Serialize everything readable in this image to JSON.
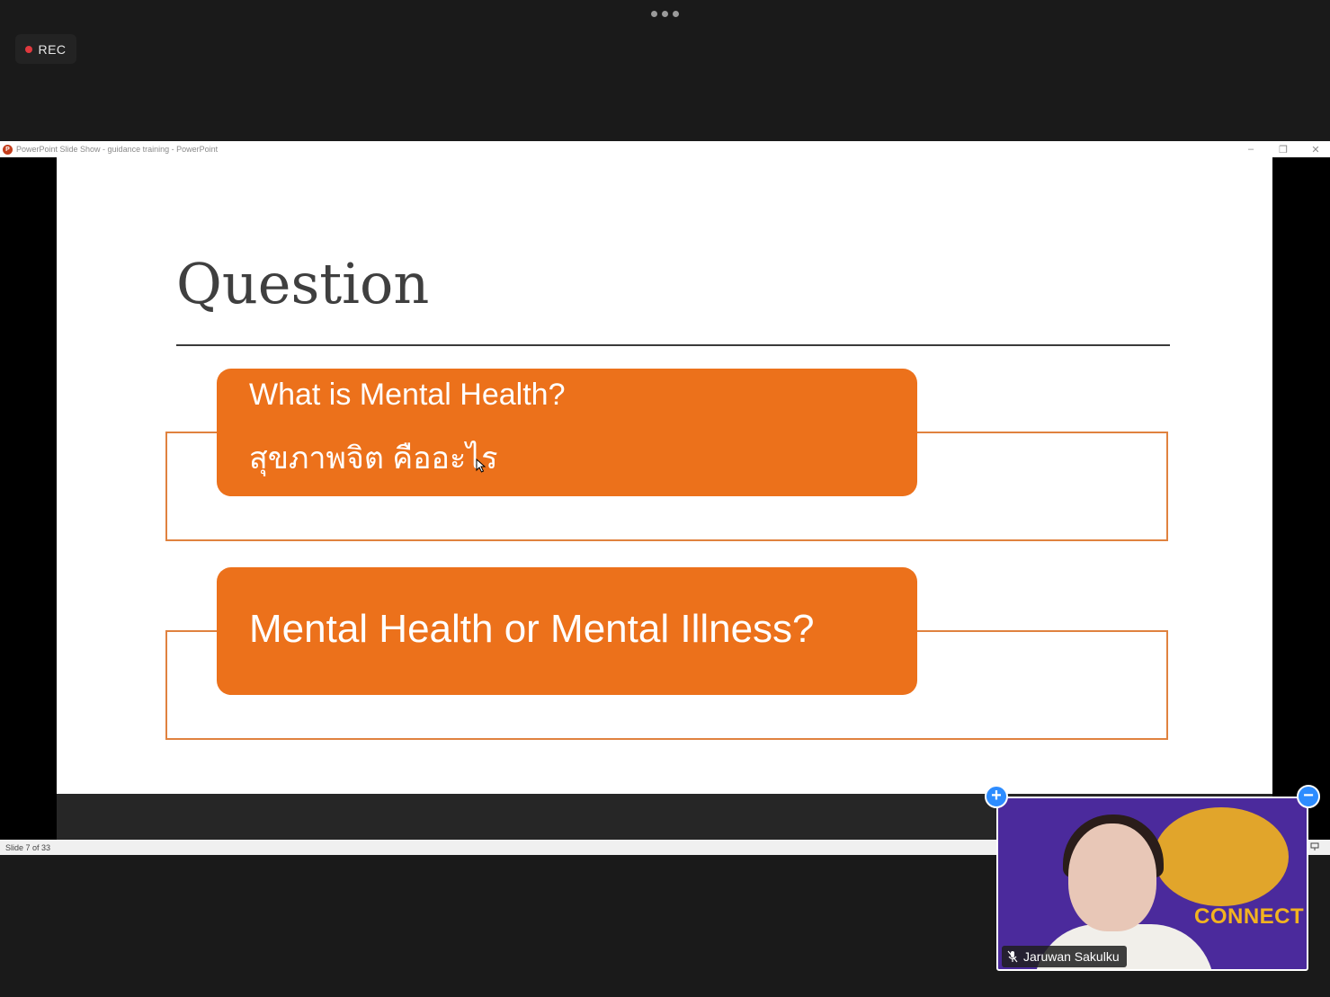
{
  "meeting": {
    "rec_label": "REC",
    "more_options": "•••"
  },
  "ppt_window": {
    "title": "PowerPoint Slide Show  -  guidance training - PowerPoint",
    "logo_letter": "P",
    "controls": {
      "minimize": "–",
      "restore": "❐",
      "close": "✕"
    },
    "status": "Slide 7 of 33"
  },
  "slide": {
    "title": "Question",
    "cards": [
      {
        "line1": "What is Mental Health?",
        "line2": "สุขภาพจิต คืออะไร"
      },
      {
        "line1": "Mental Health or Mental Illness?"
      }
    ]
  },
  "video": {
    "participant_name": "Jaruwan Sakulku",
    "background_text": "CONNECT",
    "expand_label": "+",
    "collapse_label": "−"
  },
  "colors": {
    "accent_orange": "#ec711b",
    "outline_orange": "#e0823f",
    "zoom_blue": "#2d8cff",
    "video_purple": "#4b2a9c"
  }
}
